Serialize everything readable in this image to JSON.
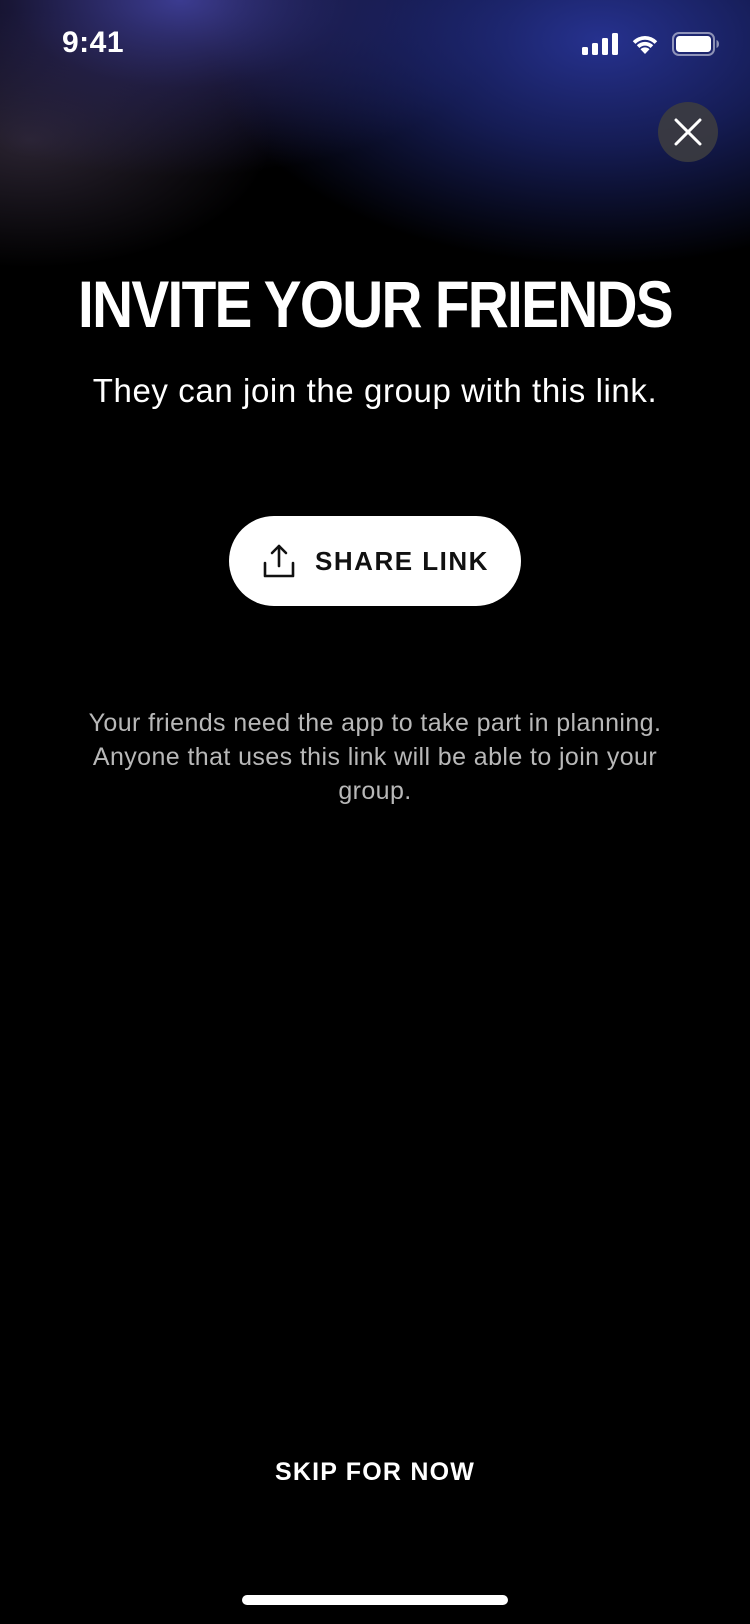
{
  "status_bar": {
    "time": "9:41",
    "icons": [
      "signal-icon",
      "wifi-icon",
      "battery-icon"
    ]
  },
  "close_button": {
    "icon": "close-icon"
  },
  "header": {
    "title": "INVITE YOUR FRIENDS",
    "subtitle": "They can join the group with this link."
  },
  "share_button": {
    "label": "SHARE LINK",
    "icon": "share-icon"
  },
  "info": {
    "text": "Your friends need the app to take part in planning. Anyone that uses this link will be able to join your group."
  },
  "footer": {
    "skip_label": "SKIP FOR NOW"
  },
  "colors": {
    "background": "#000000",
    "glow": "#2a3696",
    "button_bg": "#ffffff",
    "button_text": "#111111",
    "muted_text": "#b8b8b8"
  }
}
